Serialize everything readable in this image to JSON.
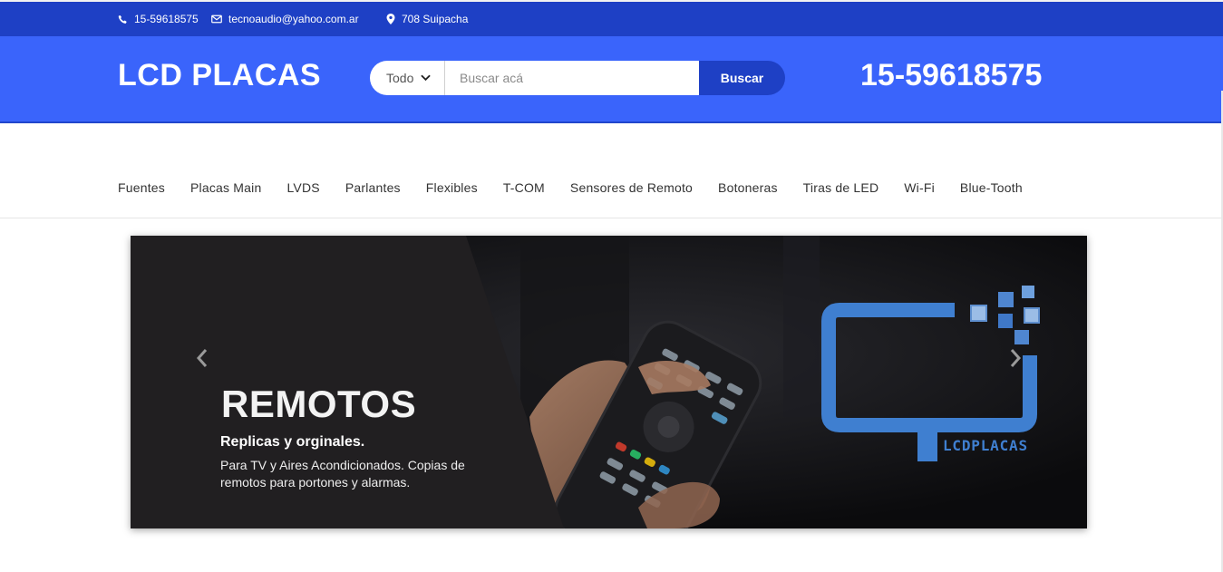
{
  "topbar": {
    "phone": "15-59618575",
    "email": "tecnoaudio@yahoo.com.ar",
    "address": "708 Suipacha"
  },
  "header": {
    "logo": "LCD PLACAS",
    "category_selected": "Todo",
    "search_placeholder": "Buscar acá",
    "search_button": "Buscar",
    "phone": "15-59618575"
  },
  "nav": {
    "items": [
      "Fuentes",
      "Placas Main",
      "LVDS",
      "Parlantes",
      "Flexibles",
      "T-COM",
      "Sensores de Remoto",
      "Botoneras",
      "Tiras de LED",
      "Wi-Fi",
      "Blue-Tooth"
    ]
  },
  "slide": {
    "title": "REMOTOS",
    "subtitle": "Replicas y orginales.",
    "description": "Para TV y Aires Acondicionados. Copias de remotos para portones y alarmas.",
    "brand_text": "LCDPLACAS"
  },
  "colors": {
    "topbar_bg": "#1e40c5",
    "header_bg": "#3a64fb",
    "brand_blue": "#3f7fd0"
  },
  "icons": {
    "phone": "phone-icon",
    "mail": "mail-icon",
    "location": "location-icon",
    "prev": "chevron-left-icon",
    "next": "chevron-right-icon",
    "dropdown": "chevron-down-icon"
  }
}
